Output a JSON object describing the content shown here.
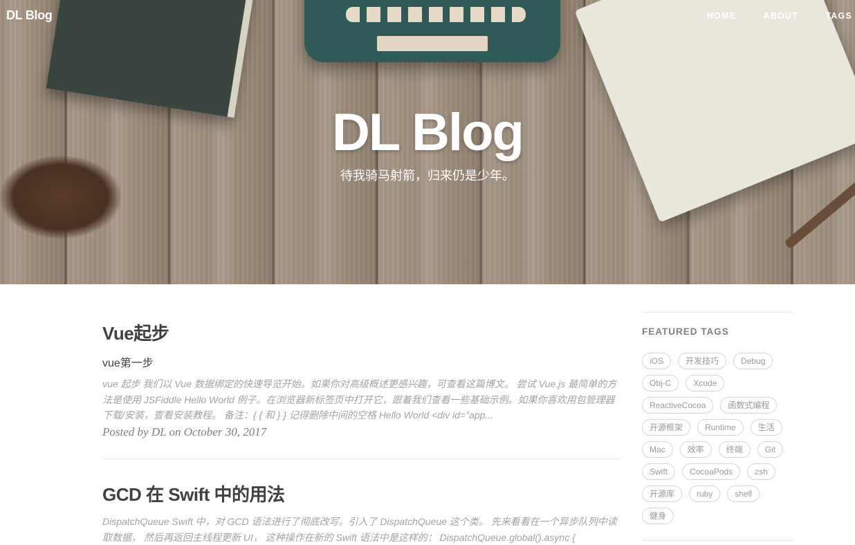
{
  "header": {
    "brand": "DL Blog",
    "nav": [
      "HOME",
      "ABOUT",
      "TAGS"
    ],
    "title": "DL Blog",
    "subtitle": "待我骑马射箭，归来仍是少年。"
  },
  "posts": [
    {
      "title": "Vue起步",
      "subtitle": "vue第一步",
      "excerpt": "vue 起步 我们以 Vue 数据绑定的快速导览开始。如果你对高级概述更感兴趣，可查看这篇博文。 尝试 Vue.js 最简单的方法是使用 JSFiddle Hello World 例子。在浏览器新标签页中打开它，跟着我们查看一些基础示例。如果你喜欢用包管理器下载/安装，查看安装教程。 备注：{ { 和 } } 记得删除中间的空格 Hello World <div id=\"app...",
      "meta": "Posted by DL on October 30, 2017"
    },
    {
      "title": "GCD 在 Swift 中的用法",
      "excerpt": "DispatchQueue Swift 中，对 GCD 语法进行了彻底改写。引入了 DispatchQueue 这个类。 先来看看在一个异步队列中读取数据， 然后再返回主线程更新 UI， 这种操作在新的 Swift 语法中是这样的： DispatchQueue.global().async {"
    }
  ],
  "sidebar": {
    "featured_title": "FEATURED TAGS",
    "tags": [
      "iOS",
      "开发技巧",
      "Debug",
      "Obj-C",
      "Xcode",
      "ReactiveCocoa",
      "函数式编程",
      "开源框架",
      "Runtime",
      "生活",
      "Mac",
      "效率",
      "终端",
      "Git",
      "Swift",
      "CocoaPods",
      "zsh",
      "开源库",
      "ruby",
      "shell",
      "健身"
    ]
  }
}
